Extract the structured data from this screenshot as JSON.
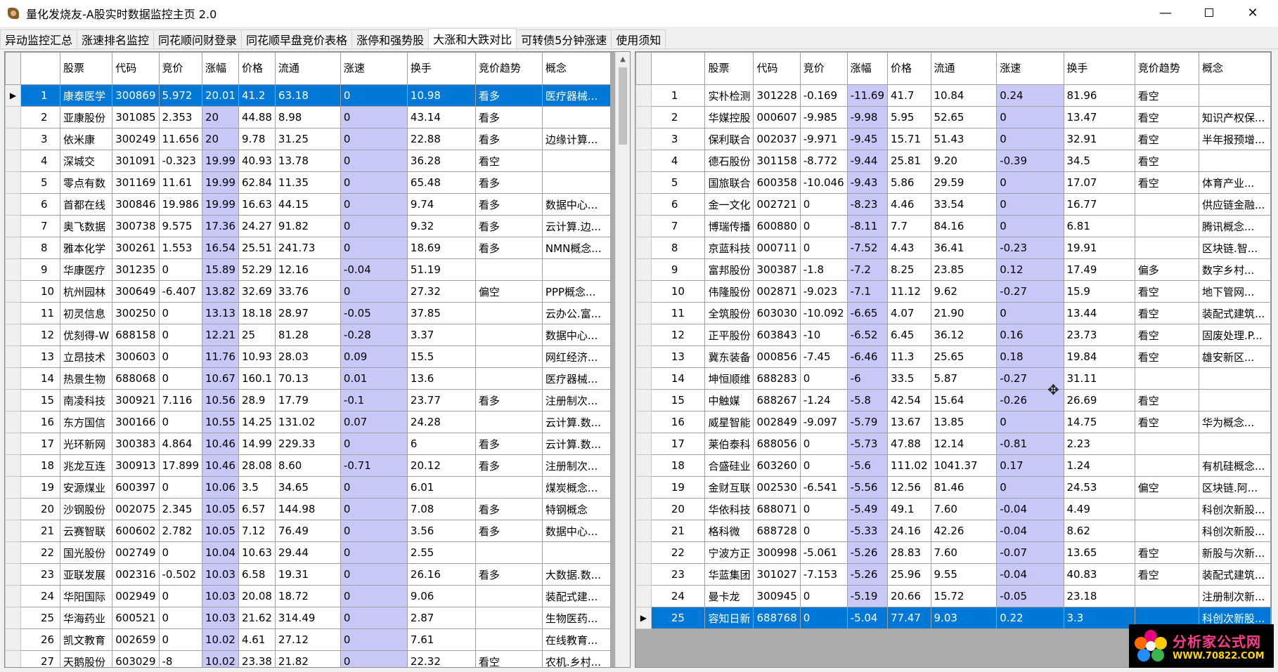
{
  "window": {
    "title": "量化发烧友-A股实时数据监控主页 2.0",
    "minimize": "—",
    "close": "✕"
  },
  "tabs": [
    {
      "label": "异动监控汇总",
      "active": false
    },
    {
      "label": "涨速排名监控",
      "active": false
    },
    {
      "label": "同花顺问财登录",
      "active": false
    },
    {
      "label": "同花顺早盘竞价表格",
      "active": false
    },
    {
      "label": "涨停和强势股",
      "active": false
    },
    {
      "label": "大涨和大跌对比",
      "active": true
    },
    {
      "label": "可转债5分钟涨速",
      "active": false
    },
    {
      "label": "使用须知",
      "active": false
    }
  ],
  "left_grid": {
    "columns": [
      "",
      "股票",
      "代码",
      "竞价",
      "涨幅",
      "价格",
      "流通",
      "涨速",
      "换手",
      "竞价趋势",
      "概念"
    ],
    "selected_row": 0,
    "rows": [
      [
        "1",
        "康泰医学",
        "300869",
        "5.972",
        "20.01",
        "41.2",
        "63.18",
        "0",
        "10.98",
        "看多",
        "医疗器械..."
      ],
      [
        "2",
        "亚康股份",
        "301085",
        "2.353",
        "20",
        "44.88",
        "8.98",
        "0",
        "43.14",
        "看多",
        ""
      ],
      [
        "3",
        "依米康",
        "300249",
        "11.656",
        "20",
        "9.78",
        "31.25",
        "0",
        "22.88",
        "看多",
        "边缘计算..."
      ],
      [
        "4",
        "深城交",
        "301091",
        "-0.323",
        "19.99",
        "40.93",
        "13.78",
        "0",
        "36.28",
        "看空",
        ""
      ],
      [
        "5",
        "零点有数",
        "301169",
        "11.61",
        "19.99",
        "62.84",
        "11.35",
        "0",
        "65.48",
        "看多",
        ""
      ],
      [
        "6",
        "首都在线",
        "300846",
        "19.986",
        "19.99",
        "16.63",
        "44.15",
        "0",
        "9.74",
        "看多",
        "数据中心..."
      ],
      [
        "7",
        "奥飞数据",
        "300738",
        "9.575",
        "17.36",
        "24.27",
        "91.82",
        "0",
        "9.32",
        "看多",
        "云计算.边..."
      ],
      [
        "8",
        "雅本化学",
        "300261",
        "1.553",
        "16.54",
        "25.51",
        "241.73",
        "0",
        "18.69",
        "看多",
        "NMN概念..."
      ],
      [
        "9",
        "华康医疗",
        "301235",
        "0",
        "15.89",
        "52.29",
        "12.16",
        "-0.04",
        "51.19",
        "",
        ""
      ],
      [
        "10",
        "杭州园林",
        "300649",
        "-6.407",
        "13.82",
        "32.69",
        "33.76",
        "0",
        "27.32",
        "偏空",
        "PPP概念..."
      ],
      [
        "11",
        "初灵信息",
        "300250",
        "0",
        "13.13",
        "18.18",
        "28.97",
        "-0.05",
        "37.85",
        "",
        "云办公.富..."
      ],
      [
        "12",
        "优刻得-W",
        "688158",
        "0",
        "12.21",
        "25",
        "81.28",
        "-0.28",
        "3.37",
        "",
        "数据中心..."
      ],
      [
        "13",
        "立昂技术",
        "300603",
        "0",
        "11.76",
        "10.93",
        "28.03",
        "0.09",
        "15.5",
        "",
        "网红经济..."
      ],
      [
        "14",
        "热景生物",
        "688068",
        "0",
        "10.67",
        "160.1",
        "70.13",
        "0.01",
        "13.6",
        "",
        "医疗器械..."
      ],
      [
        "15",
        "南凌科技",
        "300921",
        "7.116",
        "10.56",
        "28.9",
        "17.79",
        "-0.1",
        "23.77",
        "看多",
        "注册制次..."
      ],
      [
        "16",
        "东方国信",
        "300166",
        "0",
        "10.55",
        "14.25",
        "131.02",
        "0.07",
        "24.28",
        "",
        "云计算.数..."
      ],
      [
        "17",
        "光环新网",
        "300383",
        "4.864",
        "10.46",
        "14.99",
        "229.33",
        "0",
        "6",
        "看多",
        "云计算.数..."
      ],
      [
        "18",
        "兆龙互连",
        "300913",
        "17.899",
        "10.46",
        "28.08",
        "8.60",
        "-0.71",
        "20.12",
        "看多",
        "注册制次..."
      ],
      [
        "19",
        "安源煤业",
        "600397",
        "0",
        "10.06",
        "3.5",
        "34.65",
        "0",
        "6.01",
        "",
        "煤炭概念..."
      ],
      [
        "20",
        "沙钢股份",
        "002075",
        "2.345",
        "10.05",
        "6.57",
        "144.98",
        "0",
        "7.08",
        "看多",
        "特钢概念"
      ],
      [
        "21",
        "云赛智联",
        "600602",
        "2.782",
        "10.05",
        "7.12",
        "76.49",
        "0",
        "3.56",
        "看多",
        "数据中心..."
      ],
      [
        "22",
        "国光股份",
        "002749",
        "0",
        "10.04",
        "10.63",
        "29.44",
        "0",
        "2.55",
        "",
        ""
      ],
      [
        "23",
        "亚联发展",
        "002316",
        "-0.502",
        "10.03",
        "6.58",
        "19.31",
        "0",
        "26.16",
        "看多",
        "大数据.数..."
      ],
      [
        "24",
        "华阳国际",
        "002949",
        "0",
        "10.03",
        "20.08",
        "18.72",
        "0",
        "9.06",
        "",
        "装配式建..."
      ],
      [
        "25",
        "华海药业",
        "600521",
        "0",
        "10.03",
        "21.62",
        "314.49",
        "0",
        "2.87",
        "",
        "生物医药..."
      ],
      [
        "26",
        "凯文教育",
        "002659",
        "0",
        "10.02",
        "4.61",
        "27.12",
        "0",
        "7.61",
        "",
        "在线教育..."
      ],
      [
        "27",
        "天鹅股份",
        "603029",
        "-8",
        "10.02",
        "23.38",
        "21.82",
        "0",
        "22.32",
        "看空",
        "农机.乡村..."
      ]
    ]
  },
  "right_grid": {
    "columns": [
      "",
      "股票",
      "代码",
      "竞价",
      "涨幅",
      "价格",
      "流通",
      "涨速",
      "换手",
      "竞价趋势",
      "概念"
    ],
    "selected_row": 24,
    "rows": [
      [
        "1",
        "实朴检测",
        "301228",
        "-0.169",
        "-11.69",
        "41.7",
        "10.84",
        "0.24",
        "81.96",
        "看空",
        ""
      ],
      [
        "2",
        "华媒控股",
        "000607",
        "-9.985",
        "-9.98",
        "5.95",
        "52.65",
        "0",
        "13.47",
        "看空",
        "知识产权保..."
      ],
      [
        "3",
        "保利联合",
        "002037",
        "-9.971",
        "-9.45",
        "15.71",
        "51.43",
        "0",
        "32.91",
        "看空",
        "半年报预增..."
      ],
      [
        "4",
        "德石股份",
        "301158",
        "-8.772",
        "-9.44",
        "25.81",
        "9.20",
        "-0.39",
        "34.5",
        "看空",
        ""
      ],
      [
        "5",
        "国旅联合",
        "600358",
        "-10.046",
        "-9.43",
        "5.86",
        "29.59",
        "0",
        "17.07",
        "看空",
        "体育产业..."
      ],
      [
        "6",
        "金一文化",
        "002721",
        "0",
        "-8.23",
        "4.46",
        "33.54",
        "0",
        "16.77",
        "",
        "供应链金融..."
      ],
      [
        "7",
        "博瑞传播",
        "600880",
        "0",
        "-8.11",
        "7.7",
        "84.16",
        "0",
        "6.81",
        "",
        "腾讯概念..."
      ],
      [
        "8",
        "京蓝科技",
        "000711",
        "0",
        "-7.52",
        "4.43",
        "36.41",
        "-0.23",
        "19.91",
        "",
        "区块链.智..."
      ],
      [
        "9",
        "富邦股份",
        "300387",
        "-1.8",
        "-7.2",
        "8.25",
        "23.85",
        "0.12",
        "17.49",
        "偏多",
        "数字乡村..."
      ],
      [
        "10",
        "伟隆股份",
        "002871",
        "-9.023",
        "-7.1",
        "11.12",
        "9.62",
        "-0.27",
        "15.9",
        "看空",
        "地下管网..."
      ],
      [
        "11",
        "全筑股份",
        "603030",
        "-10.092",
        "-6.65",
        "4.07",
        "21.90",
        "0",
        "13.44",
        "看空",
        "装配式建筑..."
      ],
      [
        "12",
        "正平股份",
        "603843",
        "-10",
        "-6.52",
        "6.45",
        "36.12",
        "0.16",
        "23.73",
        "看空",
        "固废处理.P..."
      ],
      [
        "13",
        "冀东装备",
        "000856",
        "-7.45",
        "-6.46",
        "11.3",
        "25.65",
        "0.18",
        "19.84",
        "看空",
        "雄安新区..."
      ],
      [
        "14",
        "坤恒顺维",
        "688283",
        "0",
        "-6",
        "33.5",
        "5.87",
        "-0.27",
        "31.11",
        "",
        ""
      ],
      [
        "15",
        "中触媒",
        "688267",
        "-1.24",
        "-5.8",
        "42.54",
        "15.64",
        "-0.26",
        "26.69",
        "看空",
        ""
      ],
      [
        "16",
        "威星智能",
        "002849",
        "-9.097",
        "-5.79",
        "13.67",
        "13.85",
        "0",
        "14.75",
        "看空",
        "华为概念..."
      ],
      [
        "17",
        "莱伯泰科",
        "688056",
        "0",
        "-5.73",
        "47.88",
        "12.14",
        "-0.81",
        "2.23",
        "",
        ""
      ],
      [
        "18",
        "合盛硅业",
        "603260",
        "0",
        "-5.6",
        "111.02",
        "1041.37",
        "0.17",
        "1.24",
        "",
        "有机硅概念..."
      ],
      [
        "19",
        "金财互联",
        "002530",
        "-6.541",
        "-5.56",
        "12.56",
        "81.46",
        "0",
        "24.53",
        "偏空",
        "区块链.阿..."
      ],
      [
        "20",
        "华依科技",
        "688071",
        "0",
        "-5.49",
        "49.1",
        "7.60",
        "-0.04",
        "4.49",
        "",
        "科创次新股..."
      ],
      [
        "21",
        "格科微",
        "688728",
        "0",
        "-5.33",
        "24.16",
        "42.26",
        "-0.04",
        "8.62",
        "",
        "科创次新股..."
      ],
      [
        "22",
        "宁波方正",
        "300998",
        "-5.061",
        "-5.26",
        "28.83",
        "7.60",
        "-0.07",
        "13.65",
        "看空",
        "新股与次新..."
      ],
      [
        "23",
        "华蓝集团",
        "301027",
        "-7.153",
        "-5.26",
        "25.96",
        "9.55",
        "-0.04",
        "40.83",
        "看空",
        "装配式建筑..."
      ],
      [
        "24",
        "曼卡龙",
        "300945",
        "0",
        "-5.19",
        "20.66",
        "15.72",
        "-0.05",
        "23.18",
        "",
        "注册制次新..."
      ],
      [
        "25",
        "容知日新",
        "688768",
        "0",
        "-5.04",
        "77.47",
        "9.03",
        "0.22",
        "3.3",
        "",
        "科创次新股..."
      ]
    ]
  },
  "watermark": {
    "name": "分析家公式网",
    "url": "WWW.70822.COM"
  },
  "colors": {
    "selection": "#0078d7",
    "highlight_column": "#c8c8f8"
  }
}
